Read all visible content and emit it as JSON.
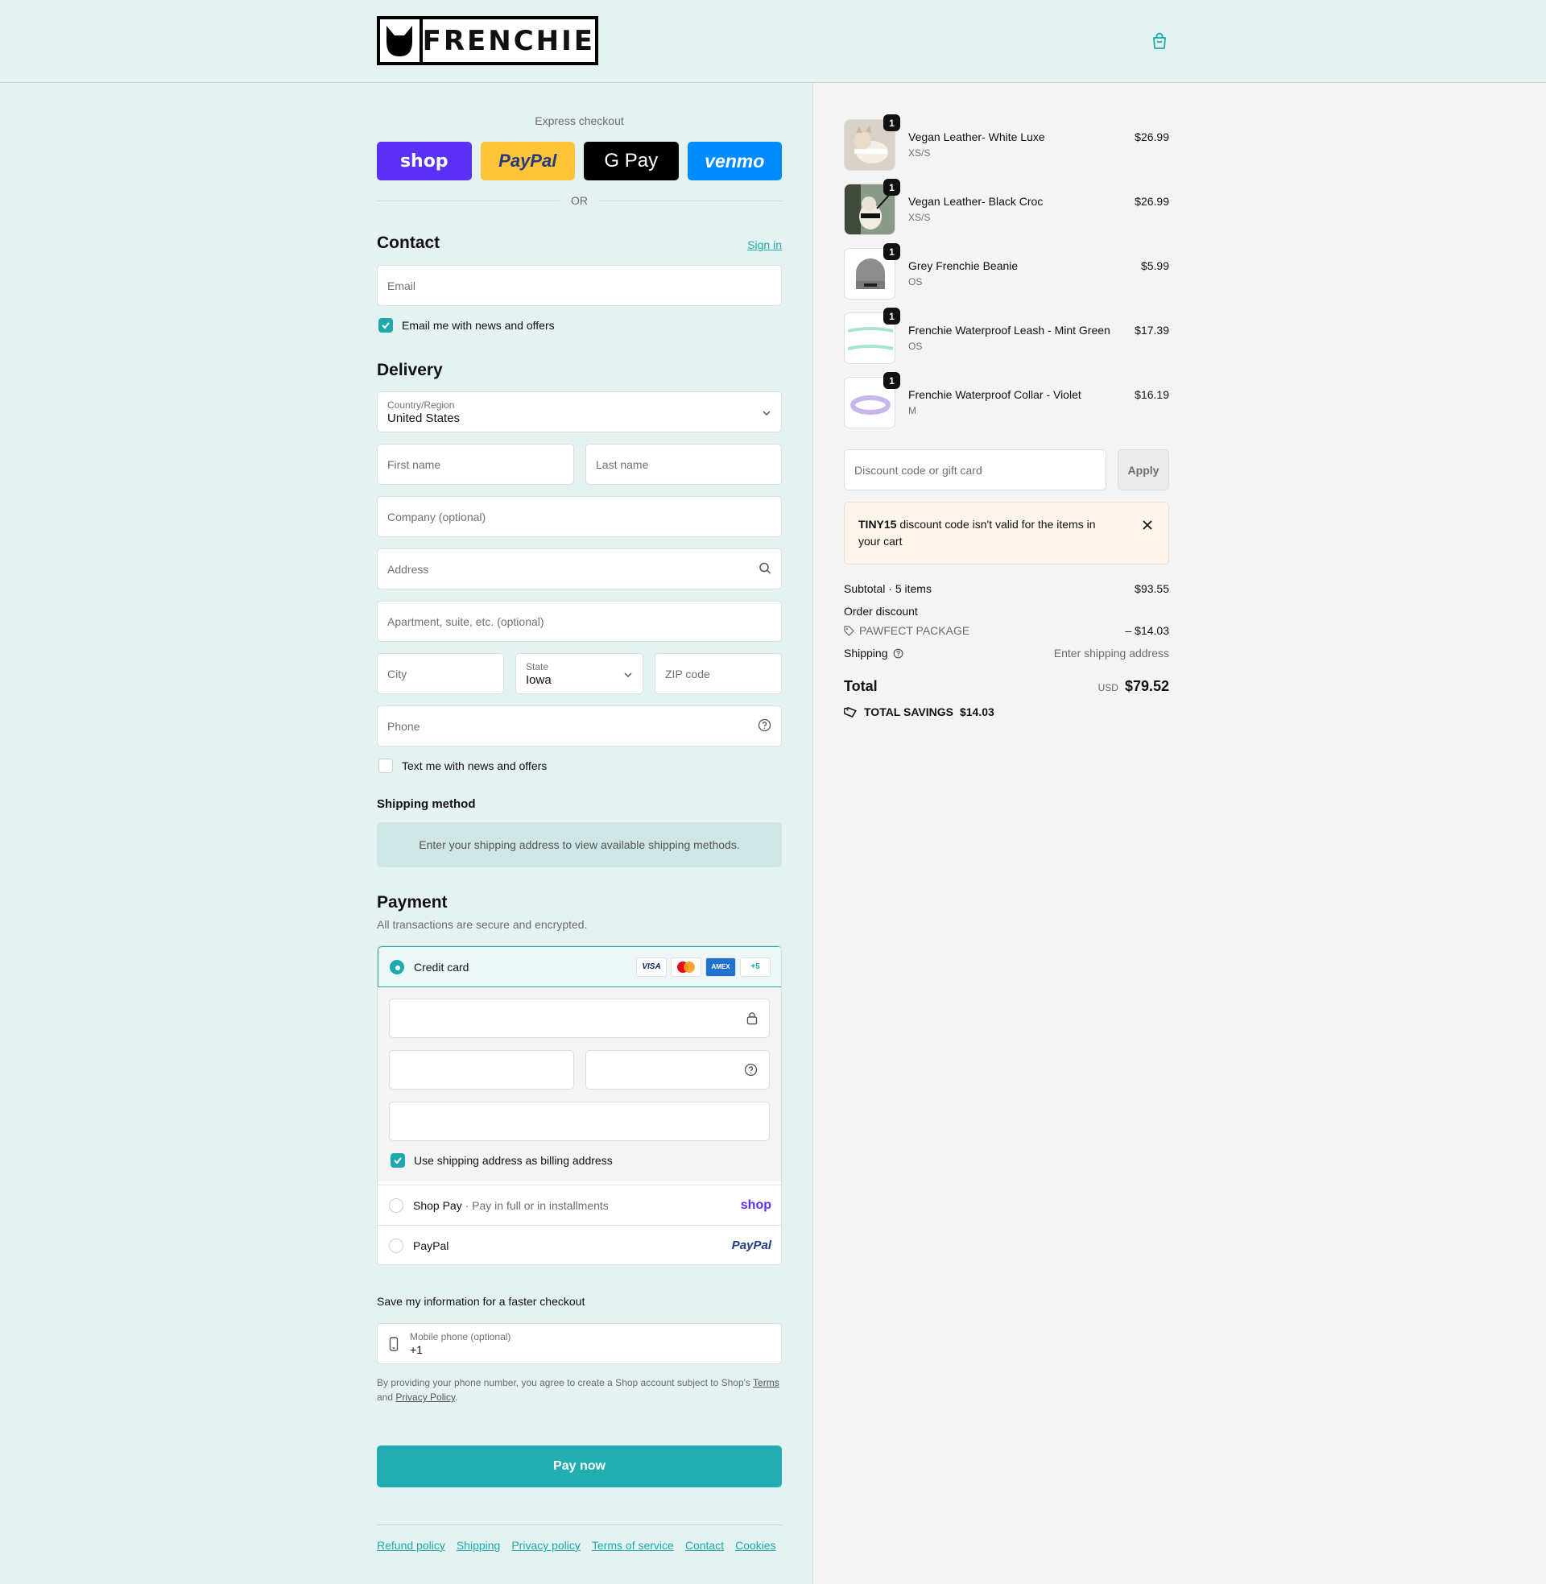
{
  "header": {
    "logo_text": "FRENCHIE",
    "cart_icon": "shopping-bag-icon"
  },
  "express": {
    "label": "Express checkout",
    "shop": "shop",
    "paypal": "PayPal",
    "gpay": "G Pay",
    "venmo": "venmo",
    "or": "OR"
  },
  "contact": {
    "title": "Contact",
    "sign_in": "Sign in",
    "email_placeholder": "Email",
    "news_label": "Email me with news and offers"
  },
  "delivery": {
    "title": "Delivery",
    "country_label": "Country/Region",
    "country_value": "United States",
    "first_name": "First name",
    "last_name": "Last name",
    "company": "Company (optional)",
    "address": "Address",
    "apartment": "Apartment, suite, etc. (optional)",
    "city": "City",
    "state_label": "State",
    "state_value": "Iowa",
    "zip": "ZIP code",
    "phone": "Phone",
    "text_label": "Text me with news and offers"
  },
  "shipping_method": {
    "title": "Shipping method",
    "note": "Enter your shipping address to view available shipping methods."
  },
  "payment": {
    "title": "Payment",
    "subtitle": "All transactions are secure and encrypted.",
    "credit_card": "Credit card",
    "badges": [
      "VISA",
      "MC",
      "AMEX",
      "+5"
    ],
    "billing_label": "Use shipping address as billing address",
    "shop_pay": "Shop Pay",
    "shop_pay_desc": "Pay in full or in installments",
    "shop_logo": "shop",
    "paypal": "PayPal",
    "paypal_logo": "PayPal"
  },
  "save_info": {
    "title": "Save my information for a faster checkout",
    "mobile_label": "Mobile phone (optional)",
    "mobile_value": "+1",
    "disclaimer_1": "By providing your phone number, you agree to create a Shop account subject to Shop's",
    "terms": "Terms",
    "and": "and",
    "privacy": "Privacy Policy",
    "period": "."
  },
  "pay_now": "Pay now",
  "footer": [
    "Refund policy",
    "Shipping",
    "Privacy policy",
    "Terms of service",
    "Contact",
    "Cookies"
  ],
  "cart": {
    "items": [
      {
        "name": "Vegan Leather- White Luxe",
        "variant": "XS/S",
        "price": "$26.99",
        "qty": "1"
      },
      {
        "name": "Vegan Leather- Black Croc",
        "variant": "XS/S",
        "price": "$26.99",
        "qty": "1"
      },
      {
        "name": "Grey Frenchie Beanie",
        "variant": "OS",
        "price": "$5.99",
        "qty": "1"
      },
      {
        "name": "Frenchie Waterproof Leash - Mint Green",
        "variant": "OS",
        "price": "$17.39",
        "qty": "1"
      },
      {
        "name": "Frenchie Waterproof Collar - Violet",
        "variant": "M",
        "price": "$16.19",
        "qty": "1"
      }
    ],
    "discount_placeholder": "Discount code or gift card",
    "apply": "Apply",
    "alert_code": "TINY15",
    "alert_text": "discount code isn't valid for the items in your cart",
    "subtotal_label": "Subtotal · 5 items",
    "subtotal_value": "$93.55",
    "order_discount_label": "Order discount",
    "discount_code": "PAWFECT PACKAGE",
    "discount_value": "– $14.03",
    "shipping_label": "Shipping",
    "shipping_value": "Enter shipping address",
    "total_label": "Total",
    "currency": "USD",
    "total_value": "$79.52",
    "savings_label": "TOTAL SAVINGS",
    "savings_value": "$14.03"
  },
  "colors": {
    "accent": "#1ea9ad",
    "left_bg": "#e5f2f2",
    "right_bg": "#f4f4f4"
  }
}
